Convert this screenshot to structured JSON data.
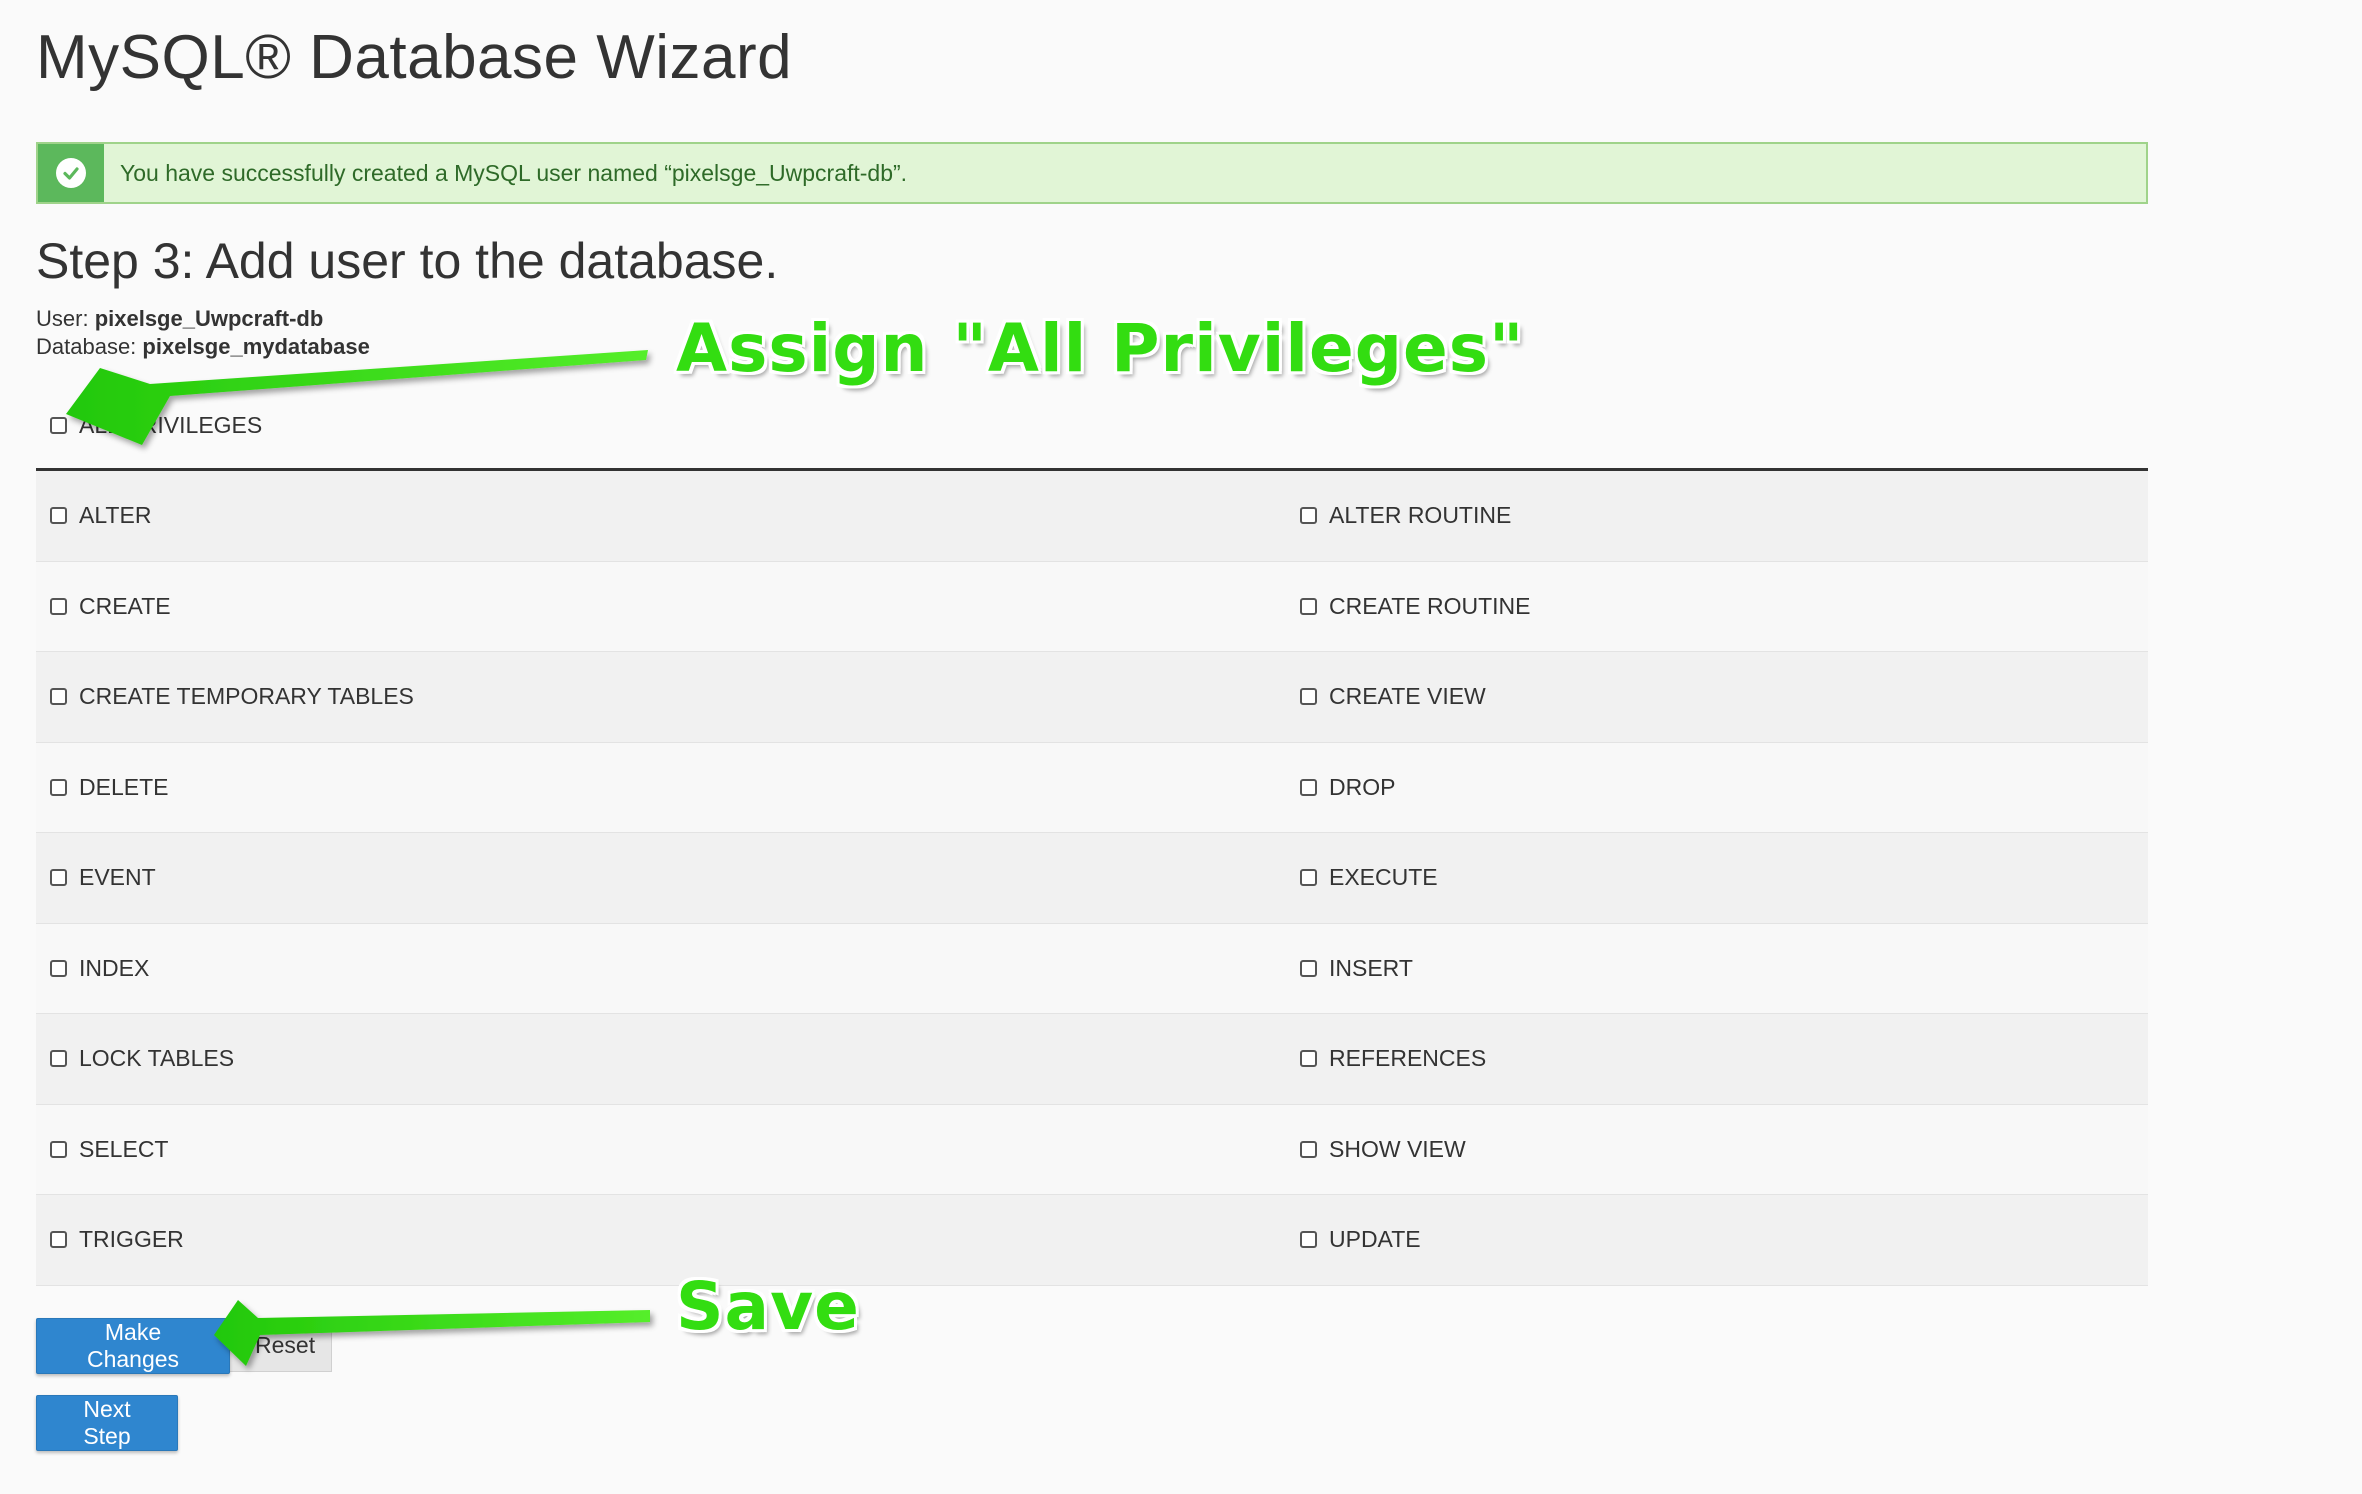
{
  "page": {
    "title": "MySQL® Database Wizard"
  },
  "alert": {
    "icon": "check-circle-icon",
    "message": "You have successfully created a MySQL user named “pixelsge_Uwpcraft-db”."
  },
  "step": {
    "title": "Step 3: Add user to the database.",
    "user_label": "User:",
    "user_value": "pixelsge_Uwpcraft-db",
    "database_label": "Database:",
    "database_value": "pixelsge_mydatabase"
  },
  "all_privileges": {
    "label": "ALL PRIVILEGES",
    "checked": false
  },
  "privileges": {
    "rows": [
      {
        "left": "ALTER",
        "right": "ALTER ROUTINE"
      },
      {
        "left": "CREATE",
        "right": "CREATE ROUTINE"
      },
      {
        "left": "CREATE TEMPORARY TABLES",
        "right": "CREATE VIEW"
      },
      {
        "left": "DELETE",
        "right": "DROP"
      },
      {
        "left": "EVENT",
        "right": "EXECUTE"
      },
      {
        "left": "INDEX",
        "right": "INSERT"
      },
      {
        "left": "LOCK TABLES",
        "right": "REFERENCES"
      },
      {
        "left": "SELECT",
        "right": "SHOW VIEW"
      },
      {
        "left": "TRIGGER",
        "right": "UPDATE"
      }
    ]
  },
  "buttons": {
    "make_changes": "Make Changes",
    "reset": "Reset",
    "next_step": "Next Step"
  },
  "annotations": {
    "assign_all": "Assign \"All Privileges\"",
    "save": "Save",
    "color": "#33dd11"
  }
}
